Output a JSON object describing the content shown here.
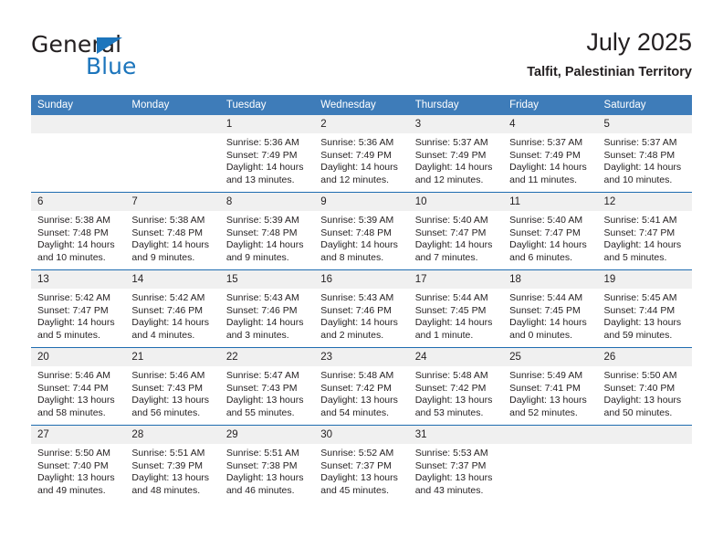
{
  "brand": {
    "name_part1": "General",
    "name_part2": "Blue",
    "triangle_color": "#1c75bc",
    "logo_icon": "triangle-right-icon"
  },
  "header": {
    "title": "July 2025",
    "subtitle": "Talfit, Palestinian Territory"
  },
  "colors": {
    "header_bar": "#3e7cb9",
    "row_divider": "#1f6cb0",
    "daynum_band": "#f0f0f0",
    "text": "#231f20",
    "brand_blue": "#1c75bc"
  },
  "weekday_headers": [
    "Sunday",
    "Monday",
    "Tuesday",
    "Wednesday",
    "Thursday",
    "Friday",
    "Saturday"
  ],
  "weeks": [
    [
      {
        "day": "",
        "empty": true
      },
      {
        "day": "",
        "empty": true
      },
      {
        "day": "1",
        "sunrise": "Sunrise: 5:36 AM",
        "sunset": "Sunset: 7:49 PM",
        "daylight": "Daylight: 14 hours and 13 minutes."
      },
      {
        "day": "2",
        "sunrise": "Sunrise: 5:36 AM",
        "sunset": "Sunset: 7:49 PM",
        "daylight": "Daylight: 14 hours and 12 minutes."
      },
      {
        "day": "3",
        "sunrise": "Sunrise: 5:37 AM",
        "sunset": "Sunset: 7:49 PM",
        "daylight": "Daylight: 14 hours and 12 minutes."
      },
      {
        "day": "4",
        "sunrise": "Sunrise: 5:37 AM",
        "sunset": "Sunset: 7:49 PM",
        "daylight": "Daylight: 14 hours and 11 minutes."
      },
      {
        "day": "5",
        "sunrise": "Sunrise: 5:37 AM",
        "sunset": "Sunset: 7:48 PM",
        "daylight": "Daylight: 14 hours and 10 minutes."
      }
    ],
    [
      {
        "day": "6",
        "sunrise": "Sunrise: 5:38 AM",
        "sunset": "Sunset: 7:48 PM",
        "daylight": "Daylight: 14 hours and 10 minutes."
      },
      {
        "day": "7",
        "sunrise": "Sunrise: 5:38 AM",
        "sunset": "Sunset: 7:48 PM",
        "daylight": "Daylight: 14 hours and 9 minutes."
      },
      {
        "day": "8",
        "sunrise": "Sunrise: 5:39 AM",
        "sunset": "Sunset: 7:48 PM",
        "daylight": "Daylight: 14 hours and 9 minutes."
      },
      {
        "day": "9",
        "sunrise": "Sunrise: 5:39 AM",
        "sunset": "Sunset: 7:48 PM",
        "daylight": "Daylight: 14 hours and 8 minutes."
      },
      {
        "day": "10",
        "sunrise": "Sunrise: 5:40 AM",
        "sunset": "Sunset: 7:47 PM",
        "daylight": "Daylight: 14 hours and 7 minutes."
      },
      {
        "day": "11",
        "sunrise": "Sunrise: 5:40 AM",
        "sunset": "Sunset: 7:47 PM",
        "daylight": "Daylight: 14 hours and 6 minutes."
      },
      {
        "day": "12",
        "sunrise": "Sunrise: 5:41 AM",
        "sunset": "Sunset: 7:47 PM",
        "daylight": "Daylight: 14 hours and 5 minutes."
      }
    ],
    [
      {
        "day": "13",
        "sunrise": "Sunrise: 5:42 AM",
        "sunset": "Sunset: 7:47 PM",
        "daylight": "Daylight: 14 hours and 5 minutes."
      },
      {
        "day": "14",
        "sunrise": "Sunrise: 5:42 AM",
        "sunset": "Sunset: 7:46 PM",
        "daylight": "Daylight: 14 hours and 4 minutes."
      },
      {
        "day": "15",
        "sunrise": "Sunrise: 5:43 AM",
        "sunset": "Sunset: 7:46 PM",
        "daylight": "Daylight: 14 hours and 3 minutes."
      },
      {
        "day": "16",
        "sunrise": "Sunrise: 5:43 AM",
        "sunset": "Sunset: 7:46 PM",
        "daylight": "Daylight: 14 hours and 2 minutes."
      },
      {
        "day": "17",
        "sunrise": "Sunrise: 5:44 AM",
        "sunset": "Sunset: 7:45 PM",
        "daylight": "Daylight: 14 hours and 1 minute."
      },
      {
        "day": "18",
        "sunrise": "Sunrise: 5:44 AM",
        "sunset": "Sunset: 7:45 PM",
        "daylight": "Daylight: 14 hours and 0 minutes."
      },
      {
        "day": "19",
        "sunrise": "Sunrise: 5:45 AM",
        "sunset": "Sunset: 7:44 PM",
        "daylight": "Daylight: 13 hours and 59 minutes."
      }
    ],
    [
      {
        "day": "20",
        "sunrise": "Sunrise: 5:46 AM",
        "sunset": "Sunset: 7:44 PM",
        "daylight": "Daylight: 13 hours and 58 minutes."
      },
      {
        "day": "21",
        "sunrise": "Sunrise: 5:46 AM",
        "sunset": "Sunset: 7:43 PM",
        "daylight": "Daylight: 13 hours and 56 minutes."
      },
      {
        "day": "22",
        "sunrise": "Sunrise: 5:47 AM",
        "sunset": "Sunset: 7:43 PM",
        "daylight": "Daylight: 13 hours and 55 minutes."
      },
      {
        "day": "23",
        "sunrise": "Sunrise: 5:48 AM",
        "sunset": "Sunset: 7:42 PM",
        "daylight": "Daylight: 13 hours and 54 minutes."
      },
      {
        "day": "24",
        "sunrise": "Sunrise: 5:48 AM",
        "sunset": "Sunset: 7:42 PM",
        "daylight": "Daylight: 13 hours and 53 minutes."
      },
      {
        "day": "25",
        "sunrise": "Sunrise: 5:49 AM",
        "sunset": "Sunset: 7:41 PM",
        "daylight": "Daylight: 13 hours and 52 minutes."
      },
      {
        "day": "26",
        "sunrise": "Sunrise: 5:50 AM",
        "sunset": "Sunset: 7:40 PM",
        "daylight": "Daylight: 13 hours and 50 minutes."
      }
    ],
    [
      {
        "day": "27",
        "sunrise": "Sunrise: 5:50 AM",
        "sunset": "Sunset: 7:40 PM",
        "daylight": "Daylight: 13 hours and 49 minutes."
      },
      {
        "day": "28",
        "sunrise": "Sunrise: 5:51 AM",
        "sunset": "Sunset: 7:39 PM",
        "daylight": "Daylight: 13 hours and 48 minutes."
      },
      {
        "day": "29",
        "sunrise": "Sunrise: 5:51 AM",
        "sunset": "Sunset: 7:38 PM",
        "daylight": "Daylight: 13 hours and 46 minutes."
      },
      {
        "day": "30",
        "sunrise": "Sunrise: 5:52 AM",
        "sunset": "Sunset: 7:37 PM",
        "daylight": "Daylight: 13 hours and 45 minutes."
      },
      {
        "day": "31",
        "sunrise": "Sunrise: 5:53 AM",
        "sunset": "Sunset: 7:37 PM",
        "daylight": "Daylight: 13 hours and 43 minutes."
      },
      {
        "day": "",
        "empty": true
      },
      {
        "day": "",
        "empty": true
      }
    ]
  ]
}
